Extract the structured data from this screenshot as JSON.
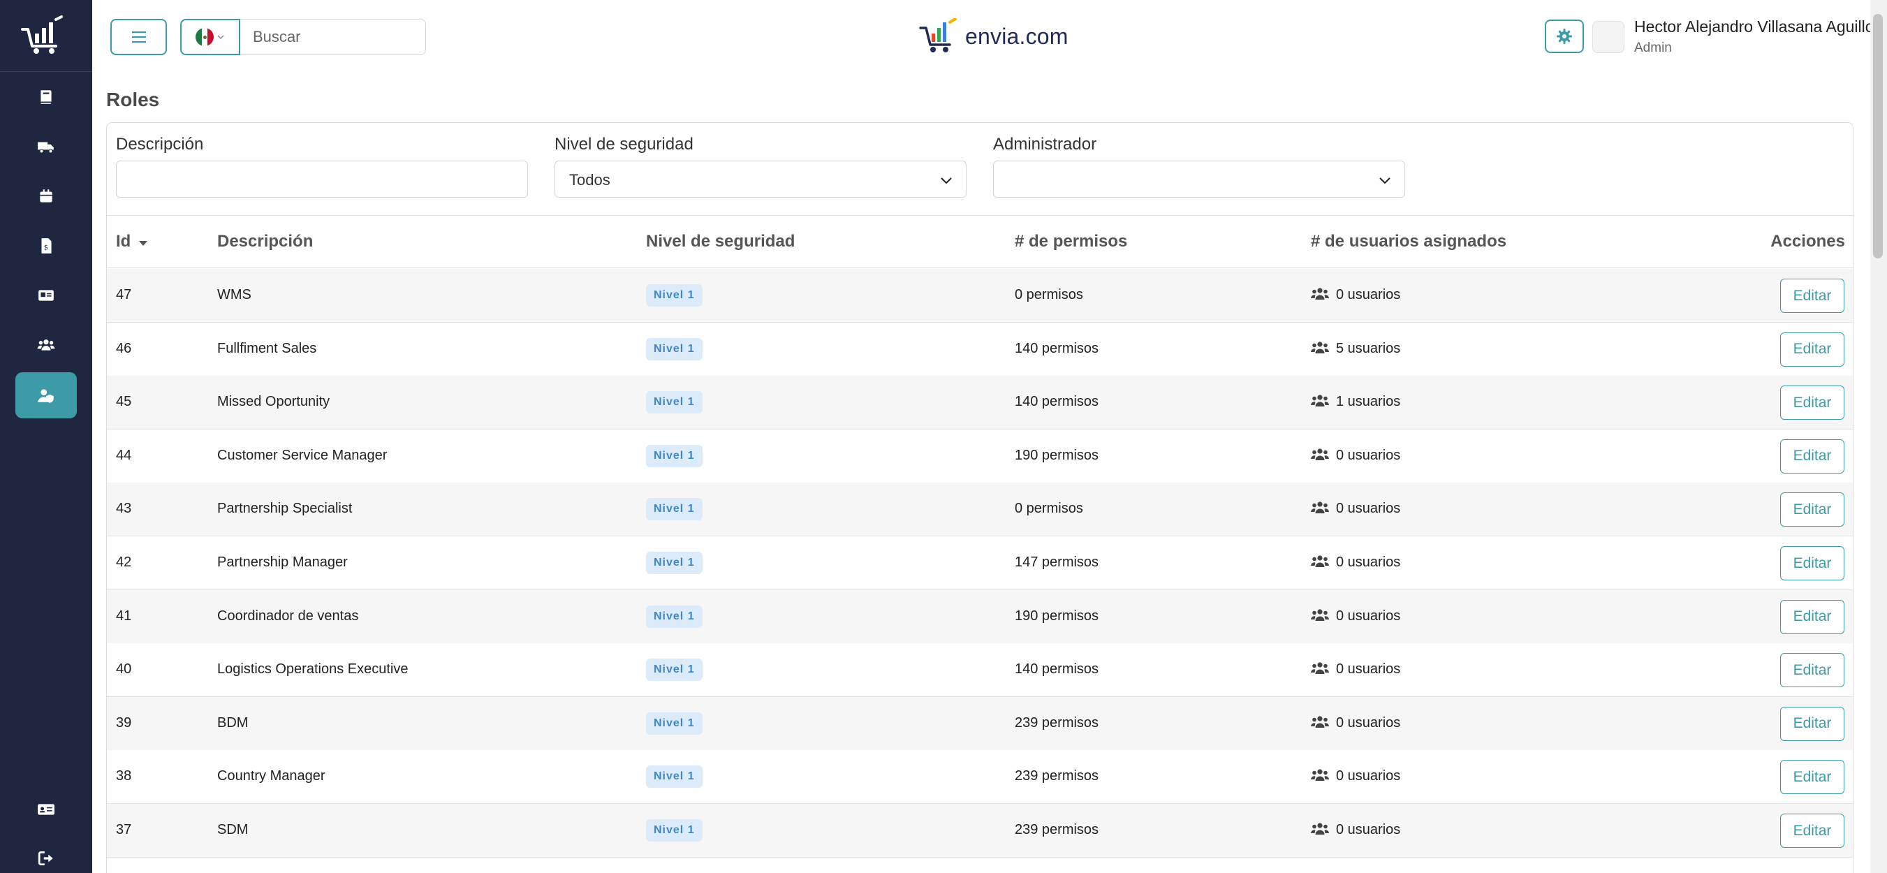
{
  "sidebar": {
    "items": [
      {
        "icon": "book-icon",
        "active": false
      },
      {
        "icon": "truck-icon",
        "active": false
      },
      {
        "icon": "box-icon",
        "active": false
      },
      {
        "icon": "invoice-icon",
        "active": false
      },
      {
        "icon": "id-card-icon",
        "active": false
      },
      {
        "icon": "users-icon",
        "active": false
      },
      {
        "icon": "user-shield-icon",
        "active": true
      }
    ],
    "bottom_items": [
      {
        "icon": "id-badge-icon"
      },
      {
        "icon": "sign-out-icon"
      }
    ]
  },
  "topbar": {
    "search_placeholder": "Buscar",
    "brand": "envia.com",
    "user_name": "Hector Alejandro Villasana Aguillon",
    "user_role": "Admin"
  },
  "page": {
    "title": "Roles"
  },
  "filters": {
    "description_label": "Descripción",
    "description_value": "",
    "security_label": "Nivel de seguridad",
    "security_value": "Todos",
    "admin_label": "Administrador",
    "admin_value": ""
  },
  "table": {
    "headers": {
      "id": "Id",
      "description": "Descripción",
      "security": "Nivel de seguridad",
      "permissions": "# de permisos",
      "users": "# de usuarios asignados",
      "actions": "Acciones"
    },
    "rows": [
      {
        "id": "47",
        "description": "WMS",
        "level": "Nivel 1",
        "permissions": "0 permisos",
        "users": "0 usuarios",
        "action": "Editar"
      },
      {
        "id": "46",
        "description": "Fullfiment Sales",
        "level": "Nivel 1",
        "permissions": "140 permisos",
        "users": "5 usuarios",
        "action": "Editar"
      },
      {
        "id": "45",
        "description": "Missed Oportunity",
        "level": "Nivel 1",
        "permissions": "140 permisos",
        "users": "1 usuarios",
        "action": "Editar"
      },
      {
        "id": "44",
        "description": "Customer Service Manager",
        "level": "Nivel 1",
        "permissions": "190 permisos",
        "users": "0 usuarios",
        "action": "Editar"
      },
      {
        "id": "43",
        "description": "Partnership Specialist",
        "level": "Nivel 1",
        "permissions": "0 permisos",
        "users": "0 usuarios",
        "action": "Editar"
      },
      {
        "id": "42",
        "description": "Partnership Manager",
        "level": "Nivel 1",
        "permissions": "147 permisos",
        "users": "0 usuarios",
        "action": "Editar"
      },
      {
        "id": "41",
        "description": "Coordinador de ventas",
        "level": "Nivel 1",
        "permissions": "190 permisos",
        "users": "0 usuarios",
        "action": "Editar"
      },
      {
        "id": "40",
        "description": "Logistics Operations Executive",
        "level": "Nivel 1",
        "permissions": "140 permisos",
        "users": "0 usuarios",
        "action": "Editar"
      },
      {
        "id": "39",
        "description": "BDM",
        "level": "Nivel 1",
        "permissions": "239 permisos",
        "users": "0 usuarios",
        "action": "Editar"
      },
      {
        "id": "38",
        "description": "Country Manager",
        "level": "Nivel 1",
        "permissions": "239 permisos",
        "users": "0 usuarios",
        "action": "Editar"
      },
      {
        "id": "37",
        "description": "SDM",
        "level": "Nivel 1",
        "permissions": "239 permisos",
        "users": "0 usuarios",
        "action": "Editar"
      }
    ]
  },
  "colors": {
    "sidebar_bg": "#1f2640",
    "accent": "#3d9aa7",
    "badge_bg": "#dcebf9",
    "badge_text": "#3f86c6"
  }
}
